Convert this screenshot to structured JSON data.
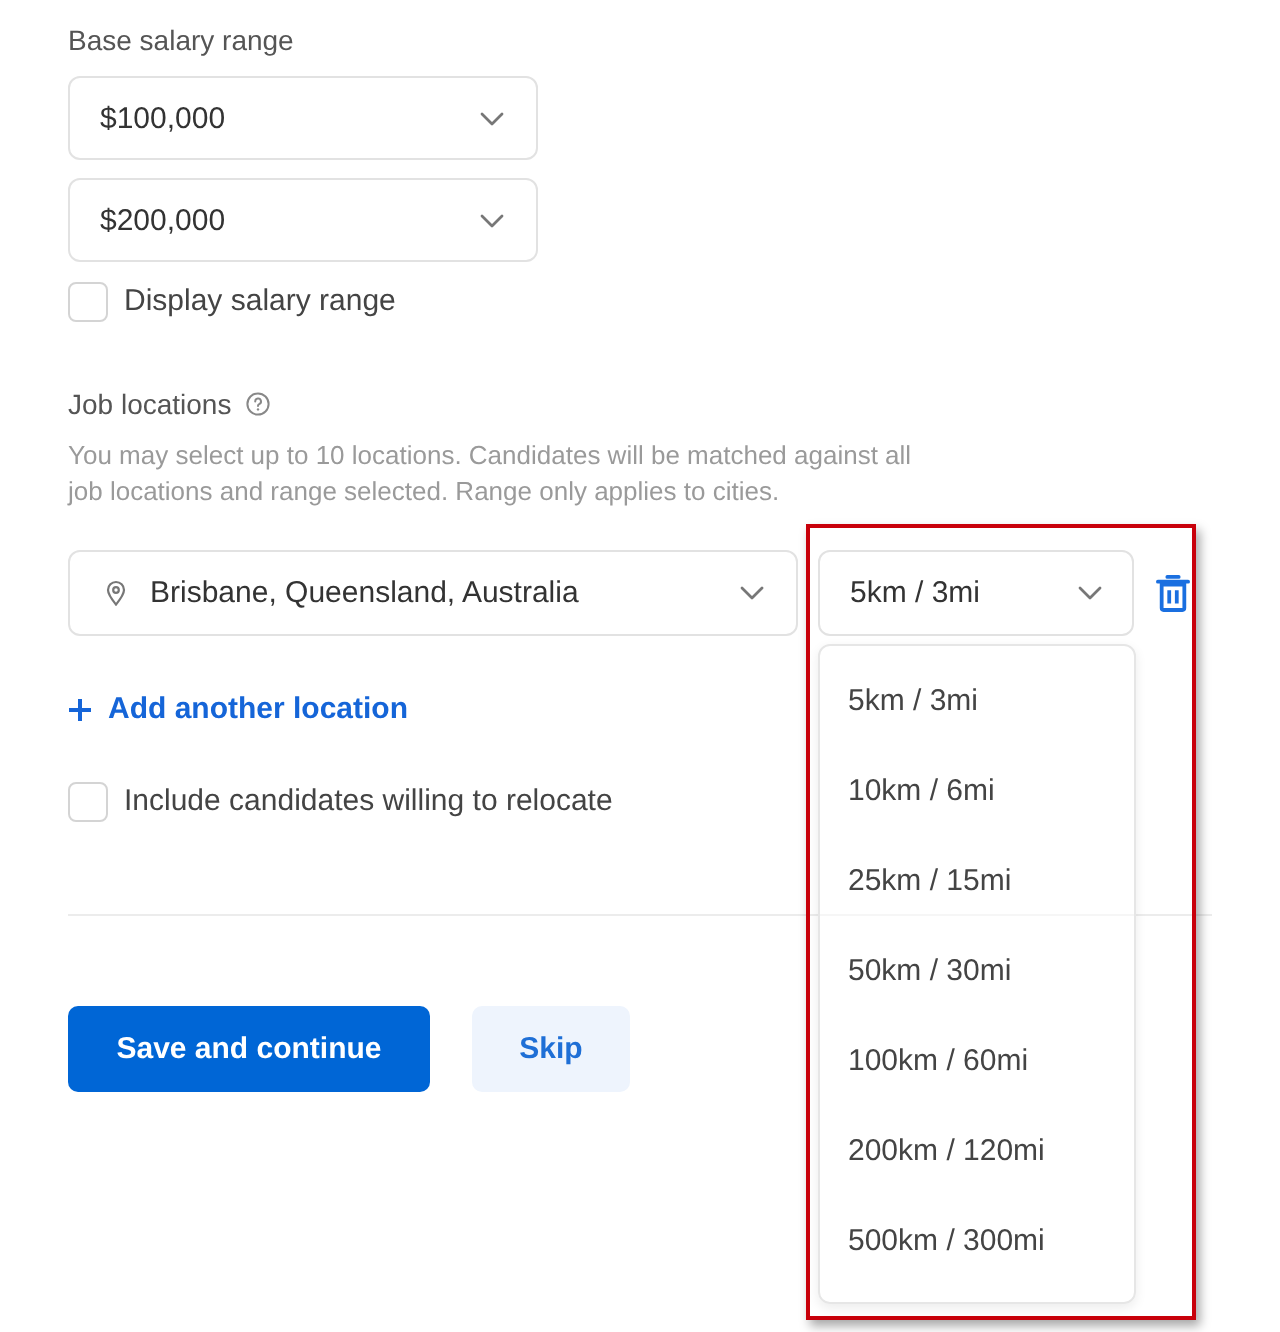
{
  "salary": {
    "label": "Base salary range",
    "selects": [
      {
        "value": "$100,000"
      },
      {
        "value": "$200,000"
      }
    ],
    "display_checkbox": {
      "label": "Display salary range",
      "checked": false
    }
  },
  "job_locations": {
    "label": "Job locations",
    "description": "You may select up to 10 locations. Candidates will be matched against all job locations and range selected. Range only applies to cities.",
    "locations": [
      {
        "place": "Brisbane, Queensland, Australia",
        "range": "5km / 3mi"
      }
    ],
    "range_dropdown": {
      "expanded": true,
      "highlighted": true,
      "options": [
        {
          "label": "5km / 3mi",
          "selected": false
        },
        {
          "label": "10km / 6mi",
          "selected": false
        },
        {
          "label": "25km / 15mi",
          "selected": false
        },
        {
          "label": "50km / 30mi",
          "selected": false
        },
        {
          "label": "100km / 60mi",
          "selected": false
        },
        {
          "label": "200km / 120mi",
          "selected": false
        },
        {
          "label": "500km / 300mi",
          "selected": false
        }
      ]
    },
    "add_link": "Add another location",
    "relocate_checkbox": {
      "label": "Include candidates willing to relocate",
      "checked": false
    }
  },
  "buttons": [
    {
      "label": "Save and continue",
      "kind": "primary"
    },
    {
      "label": "Skip",
      "kind": "secondary"
    }
  ]
}
